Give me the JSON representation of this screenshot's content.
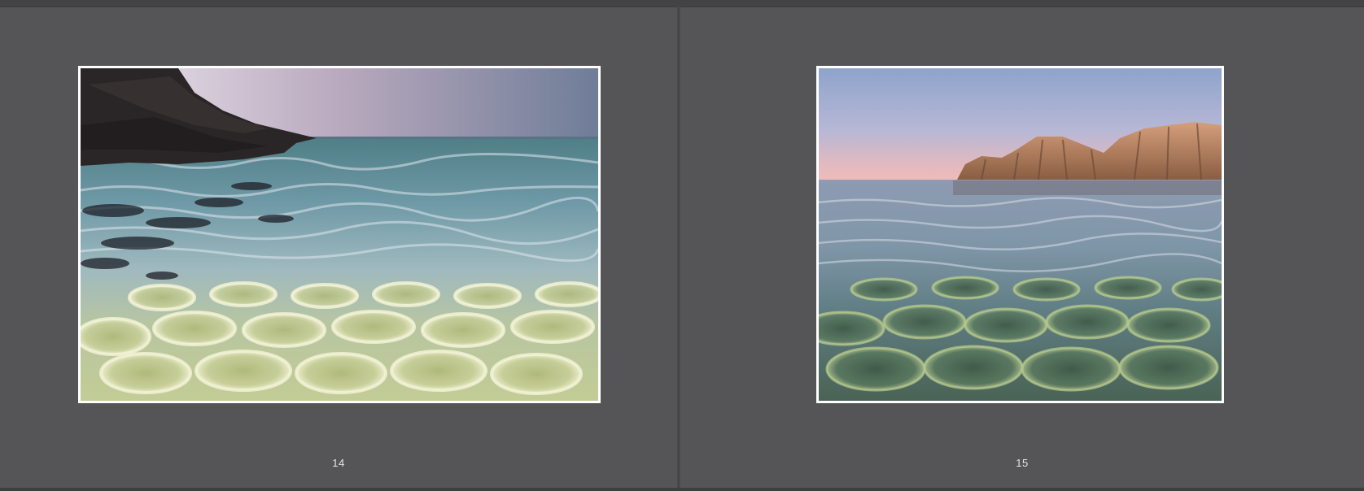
{
  "spread": {
    "left_page": {
      "number": "14"
    },
    "right_page": {
      "number": "15"
    }
  },
  "colors": {
    "background": "#555456",
    "frame": "#ffffff",
    "page_number": "#e6e6e6"
  },
  "icons": {
    "left_artwork": "painting-rocky-shore-clear-water",
    "right_artwork": "painting-rock-islands-sunset-water"
  }
}
